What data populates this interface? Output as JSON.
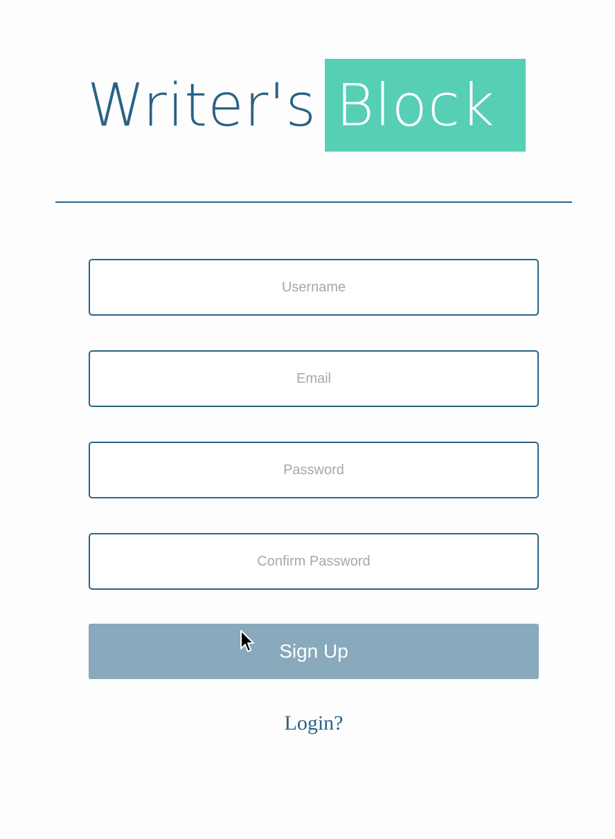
{
  "logo": {
    "part1": "Writer's",
    "part2": "Block",
    "colors": {
      "part1_text": "#2a6285",
      "part2_background": "#56cfb4",
      "part2_text": "#ffffff"
    }
  },
  "form": {
    "username": {
      "placeholder": "Username",
      "value": ""
    },
    "email": {
      "placeholder": "Email",
      "value": ""
    },
    "password": {
      "placeholder": "Password",
      "value": ""
    },
    "confirm_password": {
      "placeholder": "Confirm Password",
      "value": ""
    },
    "signup_label": "Sign Up",
    "login_link": "Login?"
  },
  "colors": {
    "accent": "#2a6285",
    "button_bg": "#89a9bc",
    "placeholder": "#a7a7a7",
    "background": "#fdfdfd"
  },
  "icons": {
    "cursor": "mouse-pointer-icon"
  }
}
